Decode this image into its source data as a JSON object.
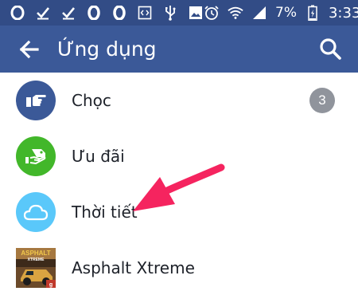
{
  "status_bar": {
    "battery_percent": "7%",
    "time": "3:33",
    "icons": [
      "opera-icon",
      "check-icon",
      "check-icon",
      "opera-icon",
      "opera-icon",
      "code-icon",
      "usb-icon",
      "image-icon",
      "alarm-icon",
      "wifi-icon",
      "signal-icon",
      "battery-icon"
    ]
  },
  "app_bar": {
    "title": "Ứng dụng",
    "back_icon": "arrow-left-icon",
    "search_icon": "search-icon"
  },
  "items": [
    {
      "label": "Chọc",
      "icon": "poke-icon",
      "color": "#3b5998",
      "badge": "3"
    },
    {
      "label": "Ưu đãi",
      "icon": "offer-icon",
      "color": "#42b72a"
    },
    {
      "label": "Thời tiết",
      "icon": "weather-icon",
      "color": "#5ac8fa"
    },
    {
      "label": "Asphalt Xtreme",
      "icon": "asphalt-game-icon"
    }
  ],
  "annotation": {
    "color": "#f5245f"
  }
}
